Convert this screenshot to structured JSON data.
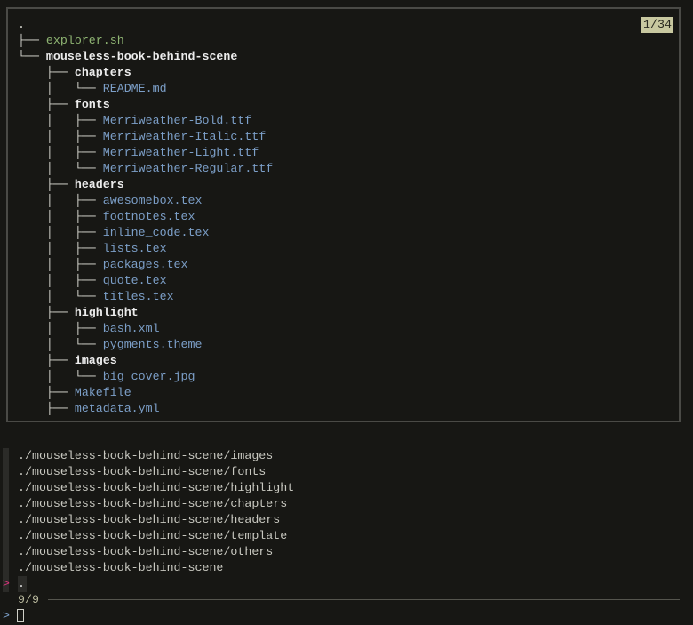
{
  "preview": {
    "counter": "1/34",
    "tree": [
      {
        "prefix": "",
        "name": ".",
        "kind": "pre"
      },
      {
        "prefix": "├── ",
        "name": "explorer.sh",
        "kind": "exe"
      },
      {
        "prefix": "└── ",
        "name": "mouseless-book-behind-scene",
        "kind": "dir"
      },
      {
        "prefix": "    ├── ",
        "name": "chapters",
        "kind": "dir"
      },
      {
        "prefix": "    │   └── ",
        "name": "README.md",
        "kind": "file"
      },
      {
        "prefix": "    ├── ",
        "name": "fonts",
        "kind": "dir"
      },
      {
        "prefix": "    │   ├── ",
        "name": "Merriweather-Bold.ttf",
        "kind": "file"
      },
      {
        "prefix": "    │   ├── ",
        "name": "Merriweather-Italic.ttf",
        "kind": "file"
      },
      {
        "prefix": "    │   ├── ",
        "name": "Merriweather-Light.ttf",
        "kind": "file"
      },
      {
        "prefix": "    │   └── ",
        "name": "Merriweather-Regular.ttf",
        "kind": "file"
      },
      {
        "prefix": "    ├── ",
        "name": "headers",
        "kind": "dir"
      },
      {
        "prefix": "    │   ├── ",
        "name": "awesomebox.tex",
        "kind": "file"
      },
      {
        "prefix": "    │   ├── ",
        "name": "footnotes.tex",
        "kind": "file"
      },
      {
        "prefix": "    │   ├── ",
        "name": "inline_code.tex",
        "kind": "file"
      },
      {
        "prefix": "    │   ├── ",
        "name": "lists.tex",
        "kind": "file"
      },
      {
        "prefix": "    │   ├── ",
        "name": "packages.tex",
        "kind": "file"
      },
      {
        "prefix": "    │   ├── ",
        "name": "quote.tex",
        "kind": "file"
      },
      {
        "prefix": "    │   └── ",
        "name": "titles.tex",
        "kind": "file"
      },
      {
        "prefix": "    ├── ",
        "name": "highlight",
        "kind": "dir"
      },
      {
        "prefix": "    │   ├── ",
        "name": "bash.xml",
        "kind": "file"
      },
      {
        "prefix": "    │   └── ",
        "name": "pygments.theme",
        "kind": "file"
      },
      {
        "prefix": "    ├── ",
        "name": "images",
        "kind": "dir"
      },
      {
        "prefix": "    │   └── ",
        "name": "big_cover.jpg",
        "kind": "file"
      },
      {
        "prefix": "    ├── ",
        "name": "Makefile",
        "kind": "file"
      },
      {
        "prefix": "    ├── ",
        "name": "metadata.yml",
        "kind": "file"
      }
    ]
  },
  "results": [
    "./mouseless-book-behind-scene/images",
    "./mouseless-book-behind-scene/fonts",
    "./mouseless-book-behind-scene/highlight",
    "./mouseless-book-behind-scene/chapters",
    "./mouseless-book-behind-scene/headers",
    "./mouseless-book-behind-scene/template",
    "./mouseless-book-behind-scene/others",
    "./mouseless-book-behind-scene"
  ],
  "selected": {
    "pointer": ">",
    "text": "."
  },
  "info": "9/9",
  "prompt": {
    "symbol": ">",
    "query": ""
  },
  "colors": {
    "pointer": "#d7337a",
    "directory": "#ececec",
    "file": "#7c9fc8",
    "executable": "#8fb573",
    "counter_bg": "#c8c8a0"
  }
}
